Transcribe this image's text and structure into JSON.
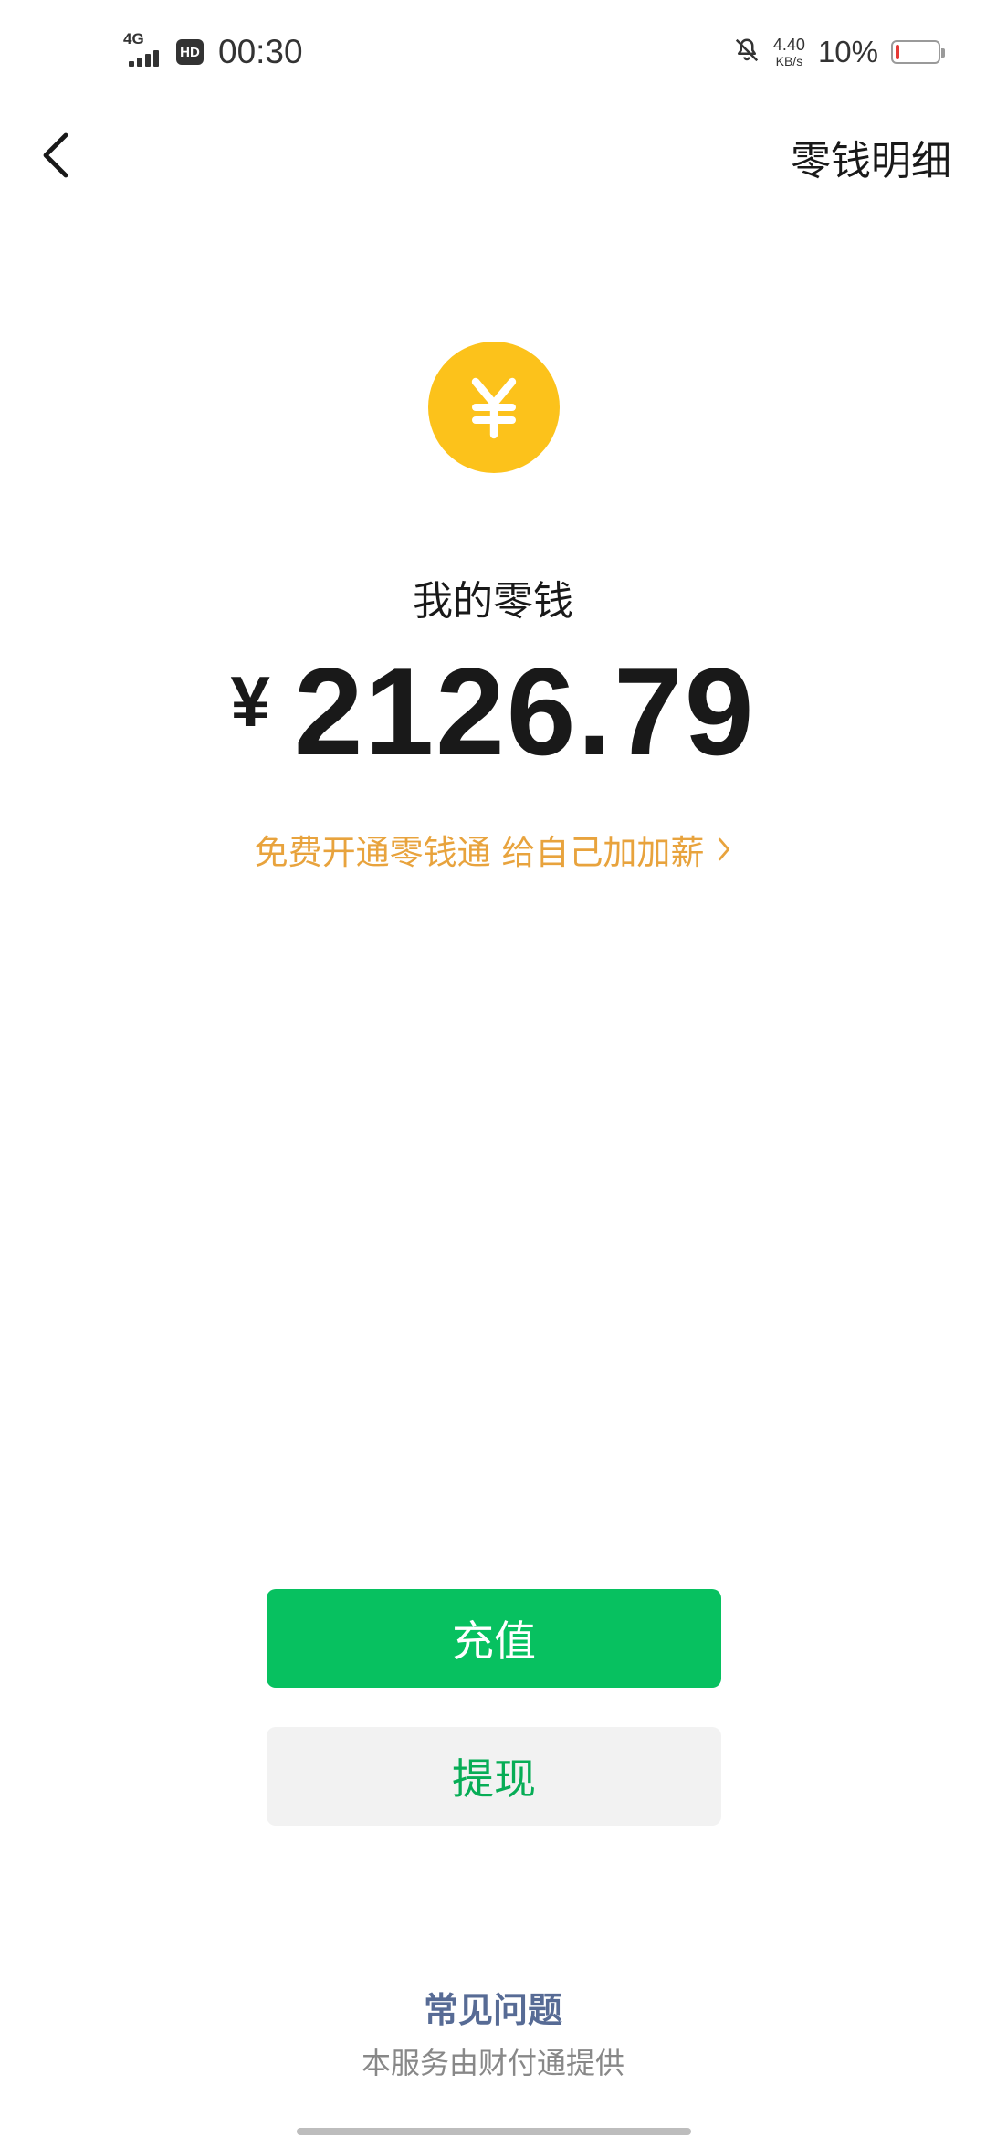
{
  "status_bar": {
    "network": "4G",
    "hd": "HD",
    "time": "00:30",
    "speed_value": "4.40",
    "speed_unit": "KB/s",
    "battery_percent": "10%",
    "battery_level": 0.1,
    "icons": [
      "signal-icon",
      "hd-icon",
      "bell-off-icon",
      "battery-icon"
    ]
  },
  "nav": {
    "back_icon": "chevron-left-icon",
    "detail_label": "零钱明细"
  },
  "wallet": {
    "coin_icon": "yuan-coin-icon",
    "label": "我的零钱",
    "currency": "¥",
    "amount": "2126.79",
    "promo_text": "免费开通零钱通 给自己加加薪"
  },
  "actions": {
    "recharge_label": "充值",
    "withdraw_label": "提现"
  },
  "footer": {
    "faq_label": "常见问题",
    "provider_text": "本服务由财付通提供"
  },
  "colors": {
    "primary_green": "#07c160",
    "withdraw_text": "#07ad56",
    "coin_yellow": "#fcc21b",
    "promo_orange": "#e8a33d",
    "link_blue": "#576b95",
    "battery_low": "#e53935"
  }
}
